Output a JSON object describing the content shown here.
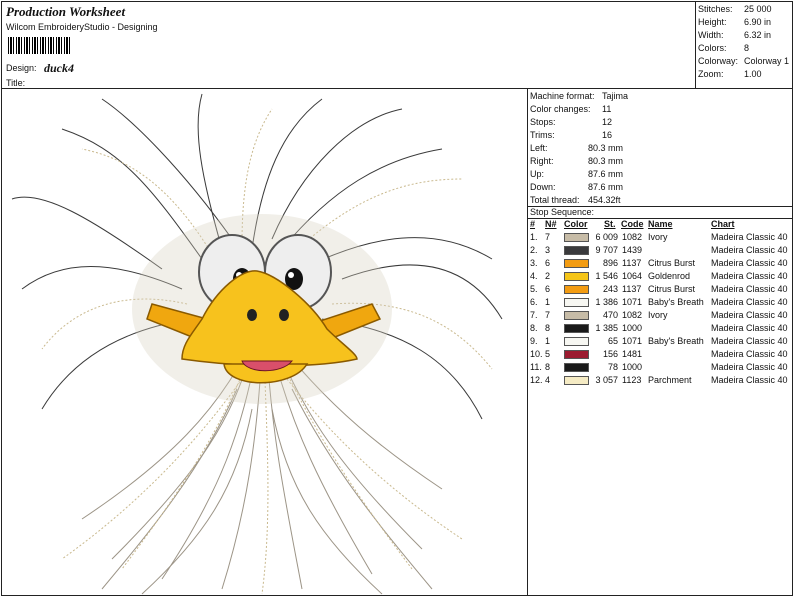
{
  "header": {
    "title": "Production Worksheet",
    "subtitle": "Wilcom EmbroideryStudio - Designing",
    "design_label": "Design:",
    "design_name": "duck4",
    "title_label": "Title:"
  },
  "stats": [
    {
      "label": "Stitches:",
      "value": "25 000"
    },
    {
      "label": "Height:",
      "value": "6.90 in"
    },
    {
      "label": "Width:",
      "value": "6.32 in"
    },
    {
      "label": "Colors:",
      "value": "8"
    },
    {
      "label": "Colorway:",
      "value": "Colorway 1"
    },
    {
      "label": "Zoom:",
      "value": "1.00"
    }
  ],
  "machine_info": [
    {
      "label": "Machine format:",
      "value": "Tajima"
    },
    {
      "label": "Color changes:",
      "value": "11"
    },
    {
      "label": "Stops:",
      "value": "12"
    },
    {
      "label": "Trims:",
      "value": "16"
    },
    {
      "label": "Left:",
      "value": "80.3 mm"
    },
    {
      "label": "Right:",
      "value": "80.3 mm"
    },
    {
      "label": "Up:",
      "value": "87.6 mm"
    },
    {
      "label": "Down:",
      "value": "87.6 mm"
    },
    {
      "label": "Total thread:",
      "value": "454.32ft"
    }
  ],
  "stop_sequence": {
    "label": "Stop Sequence:",
    "columns": {
      "num": "#",
      "n": "N#",
      "color": "Color",
      "st": "St.",
      "code": "Code",
      "name": "Name",
      "chart": "Chart"
    },
    "rows": [
      {
        "num": "1.",
        "n": "7",
        "color": "#c7bca7",
        "st": "6 009",
        "code": "1082",
        "name": "Ivory",
        "chart": "Madeira Classic 40"
      },
      {
        "num": "2.",
        "n": "3",
        "color": "#3a3a3c",
        "st": "9 707",
        "code": "1439",
        "name": "",
        "chart": "Madeira Classic 40"
      },
      {
        "num": "3.",
        "n": "6",
        "color": "#f39c12",
        "st": "896",
        "code": "1137",
        "name": "Citrus Burst",
        "chart": "Madeira Classic 40"
      },
      {
        "num": "4.",
        "n": "2",
        "color": "#f5c518",
        "st": "1 546",
        "code": "1064",
        "name": "Goldenrod",
        "chart": "Madeira Classic 40"
      },
      {
        "num": "5.",
        "n": "6",
        "color": "#f39c12",
        "st": "243",
        "code": "1137",
        "name": "Citrus Burst",
        "chart": "Madeira Classic 40"
      },
      {
        "num": "6.",
        "n": "1",
        "color": "#f7f7f2",
        "st": "1 386",
        "code": "1071",
        "name": "Baby's Breath",
        "chart": "Madeira Classic 40"
      },
      {
        "num": "7.",
        "n": "7",
        "color": "#c7bca7",
        "st": "470",
        "code": "1082",
        "name": "Ivory",
        "chart": "Madeira Classic 40"
      },
      {
        "num": "8.",
        "n": "8",
        "color": "#1a1a1a",
        "st": "1 385",
        "code": "1000",
        "name": "",
        "chart": "Madeira Classic 40"
      },
      {
        "num": "9.",
        "n": "1",
        "color": "#f7f7f2",
        "st": "65",
        "code": "1071",
        "name": "Baby's Breath",
        "chart": "Madeira Classic 40"
      },
      {
        "num": "10.",
        "n": "5",
        "color": "#9b1b30",
        "st": "156",
        "code": "1481",
        "name": "",
        "chart": "Madeira Classic 40"
      },
      {
        "num": "11.",
        "n": "8",
        "color": "#1a1a1a",
        "st": "78",
        "code": "1000",
        "name": "",
        "chart": "Madeira Classic 40"
      },
      {
        "num": "12.",
        "n": "4",
        "color": "#f5ebc4",
        "st": "3 057",
        "code": "1123",
        "name": "Parchment",
        "chart": "Madeira Classic 40"
      }
    ]
  }
}
